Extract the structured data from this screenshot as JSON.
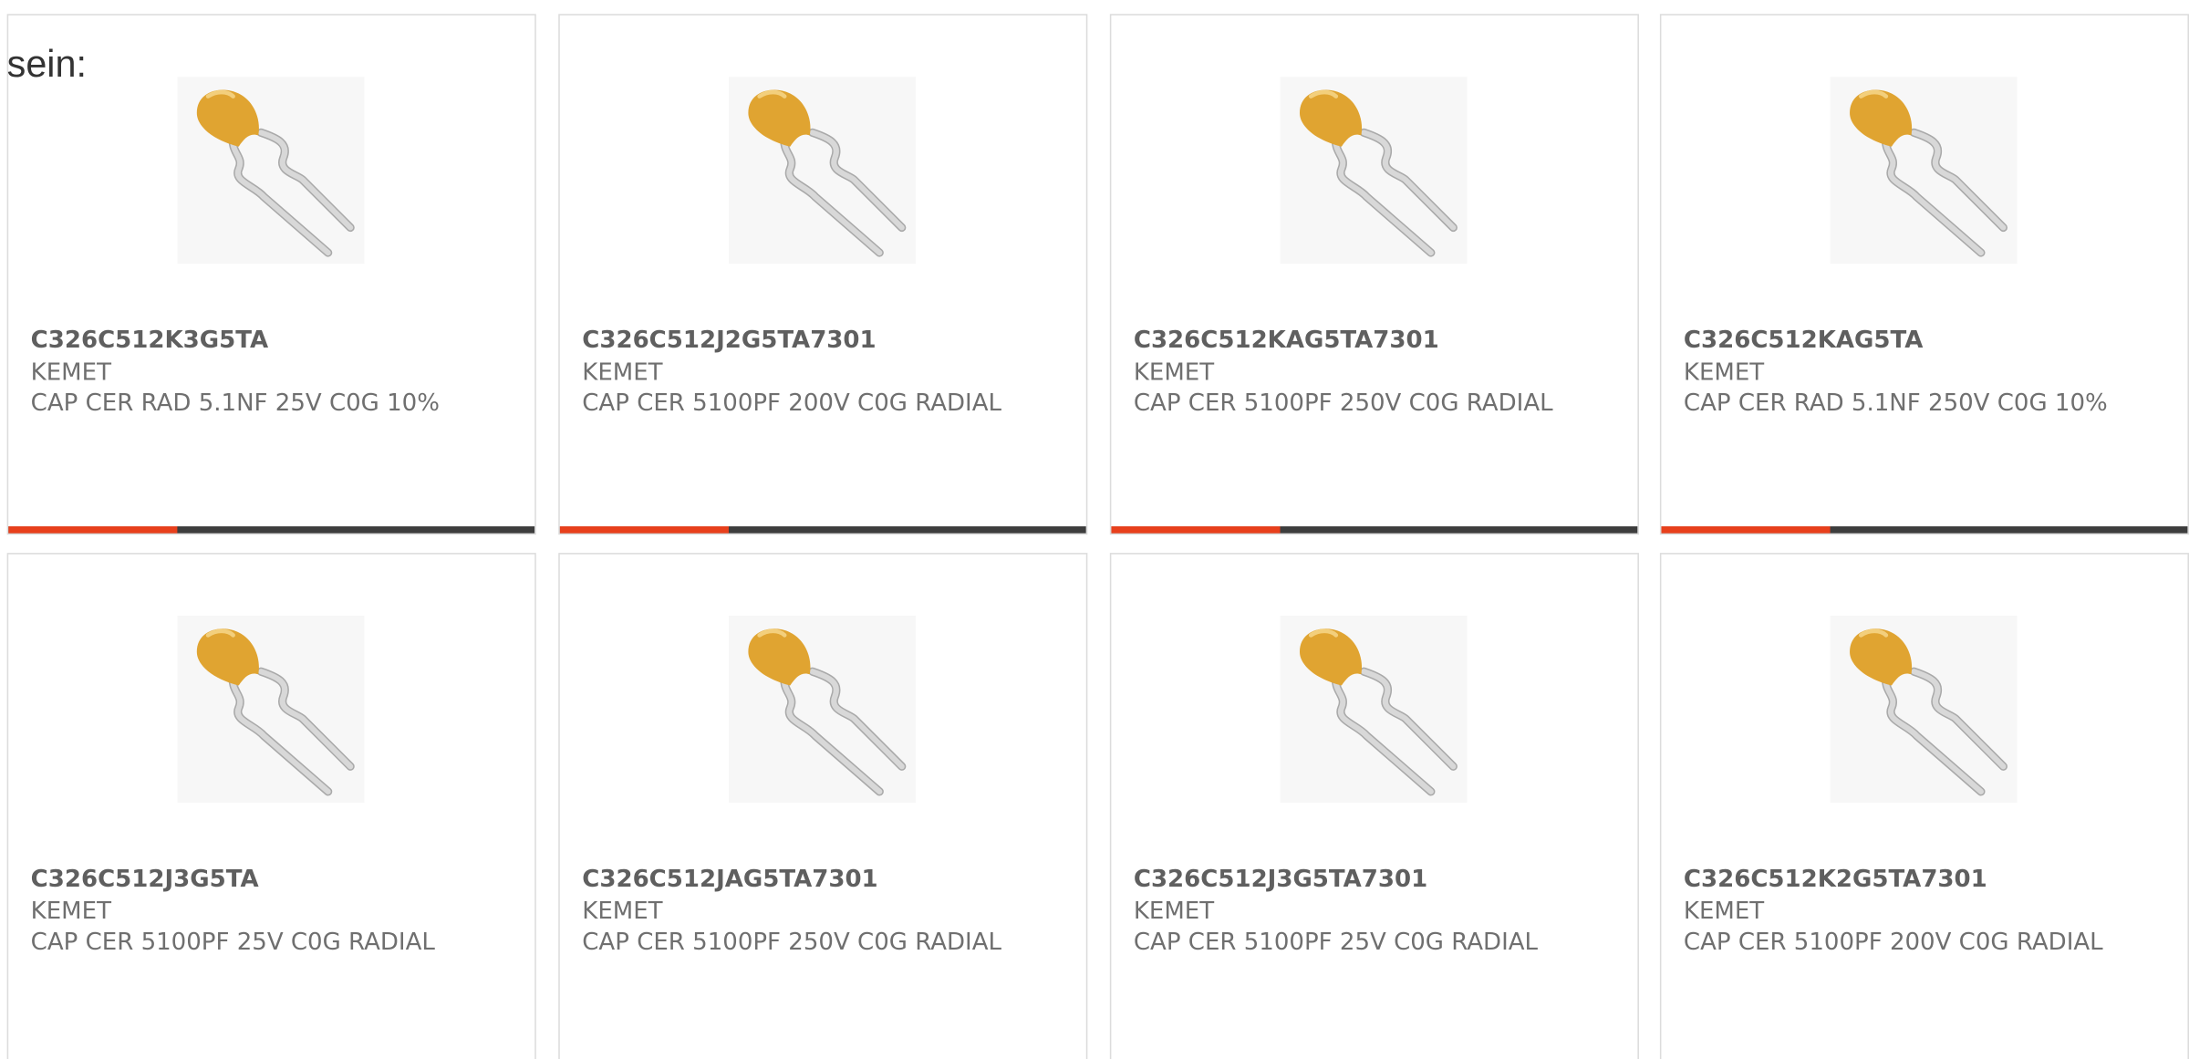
{
  "intro_text": "sein:",
  "colors": {
    "accent": "#e8401c",
    "bar_track": "#3d3d3d",
    "capacitor_body": "#e0a431",
    "lead": "#d8d8d8"
  },
  "products": [
    {
      "part_number": "C326C512K3G5TA",
      "manufacturer": "KEMET",
      "description": "CAP CER RAD 5.1NF 25V C0G 10%",
      "bar_fill": 0.32,
      "icon": "radial-capacitor-image"
    },
    {
      "part_number": "C326C512J2G5TA7301",
      "manufacturer": "KEMET",
      "description": "CAP CER 5100PF 200V C0G RADIAL",
      "bar_fill": 0.32,
      "icon": "radial-capacitor-image"
    },
    {
      "part_number": "C326C512KAG5TA7301",
      "manufacturer": "KEMET",
      "description": "CAP CER 5100PF 250V C0G RADIAL",
      "bar_fill": 0.32,
      "icon": "radial-capacitor-image"
    },
    {
      "part_number": "C326C512KAG5TA",
      "manufacturer": "KEMET",
      "description": "CAP CER RAD 5.1NF 250V C0G 10%",
      "bar_fill": 0.32,
      "icon": "radial-capacitor-image"
    },
    {
      "part_number": "C326C512J3G5TA",
      "manufacturer": "KEMET",
      "description": "CAP CER 5100PF 25V C0G RADIAL",
      "bar_fill": null,
      "icon": "radial-capacitor-image"
    },
    {
      "part_number": "C326C512JAG5TA7301",
      "manufacturer": "KEMET",
      "description": "CAP CER 5100PF 250V C0G RADIAL",
      "bar_fill": null,
      "icon": "radial-capacitor-image"
    },
    {
      "part_number": "C326C512J3G5TA7301",
      "manufacturer": "KEMET",
      "description": "CAP CER 5100PF 25V C0G RADIAL",
      "bar_fill": null,
      "icon": "radial-capacitor-image"
    },
    {
      "part_number": "C326C512K2G5TA7301",
      "manufacturer": "KEMET",
      "description": "CAP CER 5100PF 200V C0G RADIAL",
      "bar_fill": null,
      "icon": "radial-capacitor-image"
    }
  ]
}
